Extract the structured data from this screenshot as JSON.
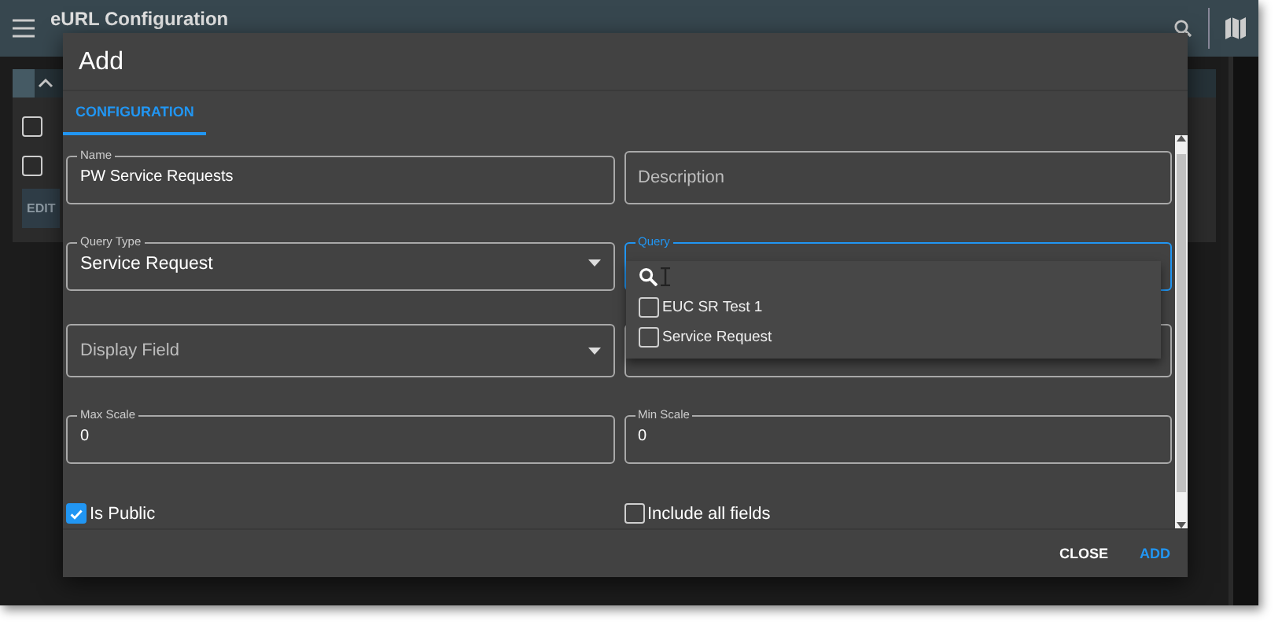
{
  "app_bar": {
    "title": "eURL Configuration"
  },
  "background": {
    "checkboxes": [
      {
        "checked": false
      },
      {
        "checked": false
      }
    ],
    "edit_button": "EDIT"
  },
  "dialog": {
    "title": "Add",
    "tabs": [
      {
        "label": "CONFIGURATION",
        "selected": true
      }
    ],
    "fields": [
      {
        "kind": "text",
        "label": "Name",
        "value": "PW Service Requests",
        "focused": false
      },
      {
        "kind": "text",
        "placeholder": "Description",
        "focused": false
      },
      {
        "kind": "select",
        "label": "Query Type",
        "value": "Service Request",
        "focused": false
      },
      {
        "kind": "multiselect",
        "label": "Query",
        "focused": true
      },
      {
        "kind": "select",
        "placeholder": "Display Field",
        "focused": false
      },
      {
        "kind": "text",
        "focused": false
      },
      {
        "kind": "text",
        "label": "Max Scale",
        "value": "0",
        "focused": false
      },
      {
        "kind": "text",
        "label": "Min Scale",
        "value": "0",
        "focused": false
      }
    ],
    "query_options": [
      {
        "label": "EUC SR Test 1",
        "checked": false
      },
      {
        "label": "Service Request",
        "checked": false
      }
    ],
    "checkboxes": [
      {
        "label": "Is Public",
        "checked": true
      },
      {
        "label": "Include all fields",
        "checked": false
      }
    ],
    "buttons": [
      {
        "label": "CLOSE",
        "kind": "text"
      },
      {
        "label": "ADD",
        "kind": "primary"
      }
    ]
  }
}
